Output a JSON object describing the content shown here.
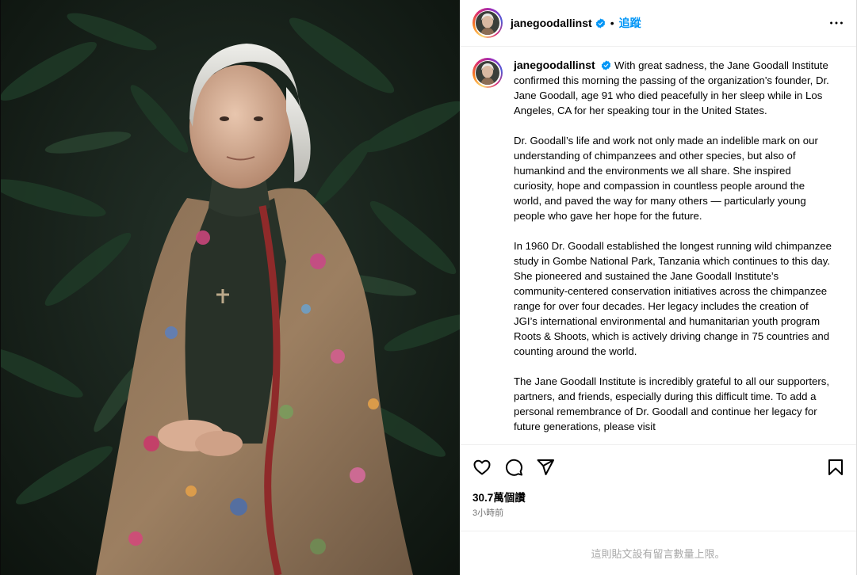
{
  "post": {
    "username": "janegoodallinst",
    "follow_label": "追蹤",
    "dot": "•",
    "caption_paragraphs": [
      "With great sadness, the Jane Goodall Institute confirmed this morning the passing of the organization’s founder, Dr. Jane Goodall, age 91 who died peacefully in her sleep while in Los Angeles, CA for her speaking tour in the United States.",
      "Dr. Goodall’s life and work not only made an indelible mark on our understanding of chimpanzees and other species, but also of humankind and the environments we all share. She inspired curiosity, hope and compassion in countless people around the world, and paved the way for many others — particularly young people who gave her hope for the future.",
      "In 1960 Dr. Goodall established the longest running wild chimpanzee study in Gombe National Park, Tanzania which continues to this day. She pioneered and sustained the Jane Goodall Institute’s community-centered conservation initiatives across the chimpanzee range for over four decades. Her legacy includes the creation of JGI’s international environmental and humanitarian youth program Roots & Shoots, which is actively driving change in 75 countries and counting around the world.",
      "The Jane Goodall Institute is incredibly grateful to all our supporters, partners, and friends, especially during this difficult time. To add a personal remembrance of Dr. Goodall and continue her legacy for future generations, please visit"
    ],
    "likes": "30.7萬個讚",
    "time_ago": "3小時前",
    "comments_disabled": "這則貼文設有留言數量上限。"
  },
  "icons": {
    "verified": "verified-badge-icon",
    "more": "more-options-icon",
    "like": "heart-icon",
    "comment": "comment-icon",
    "share": "share-icon",
    "save": "bookmark-icon"
  },
  "colors": {
    "link_blue": "#0095f6",
    "verified_blue": "#0095f6",
    "muted": "#737373"
  }
}
